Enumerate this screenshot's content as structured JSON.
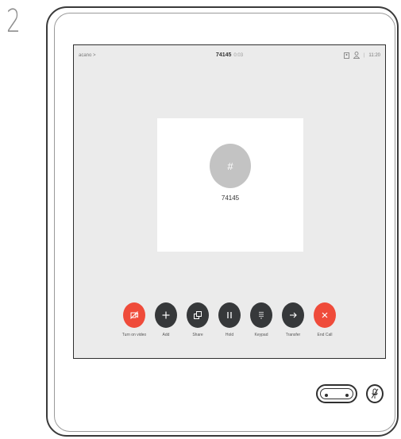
{
  "step_number": "2",
  "status_bar": {
    "left_label": "acano >",
    "call_number": "74145",
    "call_duration": "0:03",
    "divider": "|",
    "time": "11:20"
  },
  "call_card": {
    "avatar_symbol": "#",
    "caller_number": "74145"
  },
  "controls": [
    {
      "label": "Turn on video",
      "icon": "video-off-icon",
      "color": "#ef4b3a"
    },
    {
      "label": "Add",
      "icon": "plus-icon",
      "color": "#36383a"
    },
    {
      "label": "Share",
      "icon": "share-screen-icon",
      "color": "#36383a"
    },
    {
      "label": "Hold",
      "icon": "pause-icon",
      "color": "#36383a"
    },
    {
      "label": "Keypad",
      "icon": "keypad-icon",
      "color": "#36383a"
    },
    {
      "label": "Transfer",
      "icon": "arrow-right-icon",
      "color": "#36383a"
    },
    {
      "label": "End Call",
      "icon": "close-icon",
      "color": "#ef4b3a"
    }
  ]
}
